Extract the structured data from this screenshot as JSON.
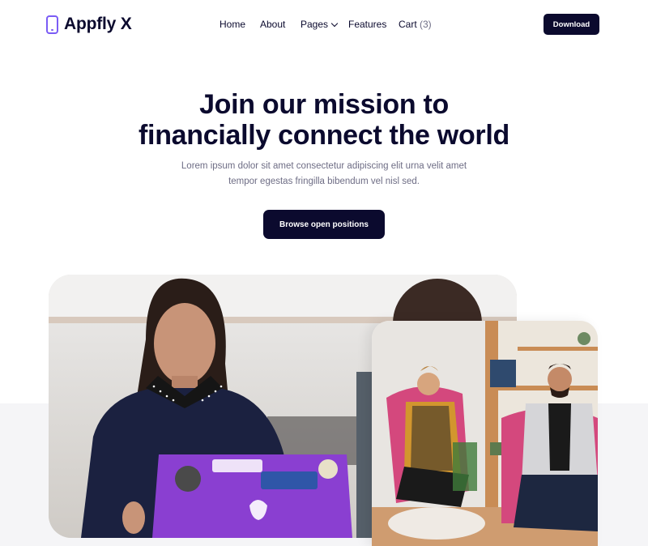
{
  "brand": {
    "name": "Appfly X",
    "icon": "phone-icon",
    "accent": "#7b5cf5"
  },
  "nav": {
    "items": [
      {
        "label": "Home"
      },
      {
        "label": "About"
      },
      {
        "label": "Pages",
        "icon": "chevron-down-icon"
      },
      {
        "label": "Features"
      },
      {
        "label": "Cart",
        "count": "(3)"
      }
    ],
    "download_label": "Download"
  },
  "hero": {
    "title_line1": "Join our mission to",
    "title_line2": "financially connect the world",
    "description": "Lorem ipsum dolor sit amet consectetur adipiscing elit urna velit amet tempor egestas fringilla bibendum vel nisl sed.",
    "cta_label": "Browse open positions"
  },
  "colors": {
    "primary_dark": "#0b0a2e",
    "muted_text": "#6e6d85",
    "band": "#f5f5f7"
  }
}
